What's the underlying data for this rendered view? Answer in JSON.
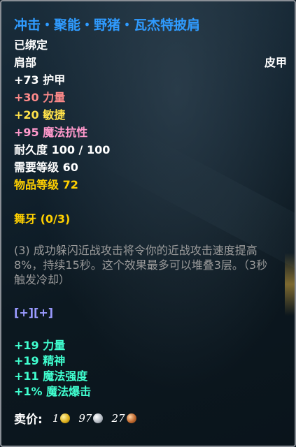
{
  "item": {
    "name": "冲击・聚能・野猪・瓦杰特披肩",
    "binding": "已绑定",
    "slot": "肩部",
    "armor_type": "皮甲",
    "armor": "+73 护甲",
    "stats": [
      {
        "text": "+30 力量",
        "color": "#ff8a8a"
      },
      {
        "text": "+20 敏捷",
        "color": "#ffe24a"
      },
      {
        "text": "+95 魔法抗性",
        "color": "#ff99cc"
      }
    ],
    "durability": "耐久度 100 / 100",
    "required_level": "需要等级 60",
    "item_level": "物品等级 72",
    "set_name": "舞牙 (0/3)",
    "set_bonus": "(3) 成功躲闪近战攻击将令你的近战攻击速度提高8%，持续15秒。这个效果最多可以堆叠3层。（3秒触发冷却）",
    "sockets": "[+][+]",
    "enchant_stats": [
      "+19 力量",
      "+19 精神",
      "+11 魔法强度",
      "+1% 魔法爆击"
    ],
    "sell_label": "卖价:",
    "price": {
      "gold": "1",
      "silver": "97",
      "copper": "27"
    }
  },
  "colors": {
    "title": "#2f9bff",
    "white": "#ffffff",
    "item_level": "#ffd000",
    "set_name": "#ffd000",
    "set_bonus": "#9a9a9a",
    "sockets": "#9a9aff",
    "enchant": "#40ffd0"
  }
}
